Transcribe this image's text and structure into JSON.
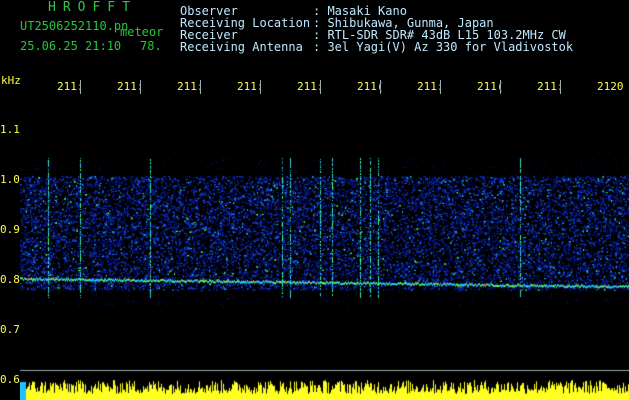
{
  "header": {
    "logo": "HROFFT",
    "filename": "UT2506252110.pn",
    "tag": "meteor",
    "datetime": "25.06.25 21:10",
    "count": "78.",
    "info_labels": [
      "Observer",
      "Receiving Location",
      "Receiver",
      "Receiving Antenna"
    ],
    "info_values": [
      ": Masaki Kano",
      ": Shibukawa, Gunma, Japan",
      ": RTL-SDR SDR# 43dB L15 103.2MHz CW",
      ": 3el Yagi(V) Az 330 for Vladivostok"
    ]
  },
  "time_axis": {
    "labels": [
      "211:",
      "211:",
      "211:",
      "211:",
      "211:",
      "211(",
      "211:",
      "211(",
      "211:",
      "2120"
    ]
  },
  "freq_axis": {
    "unit": "kHz",
    "ticks": [
      "1.1",
      "1.0",
      "0.9",
      "0.8",
      "0.7",
      "0.6"
    ]
  },
  "colors": {
    "background": "#000000",
    "text_green": "#22c93a",
    "text_light": "#bfe8ff",
    "axis_yellow": "#ffff40",
    "noise_blue": "#1030c0",
    "signal_green": "#40ff60"
  }
}
